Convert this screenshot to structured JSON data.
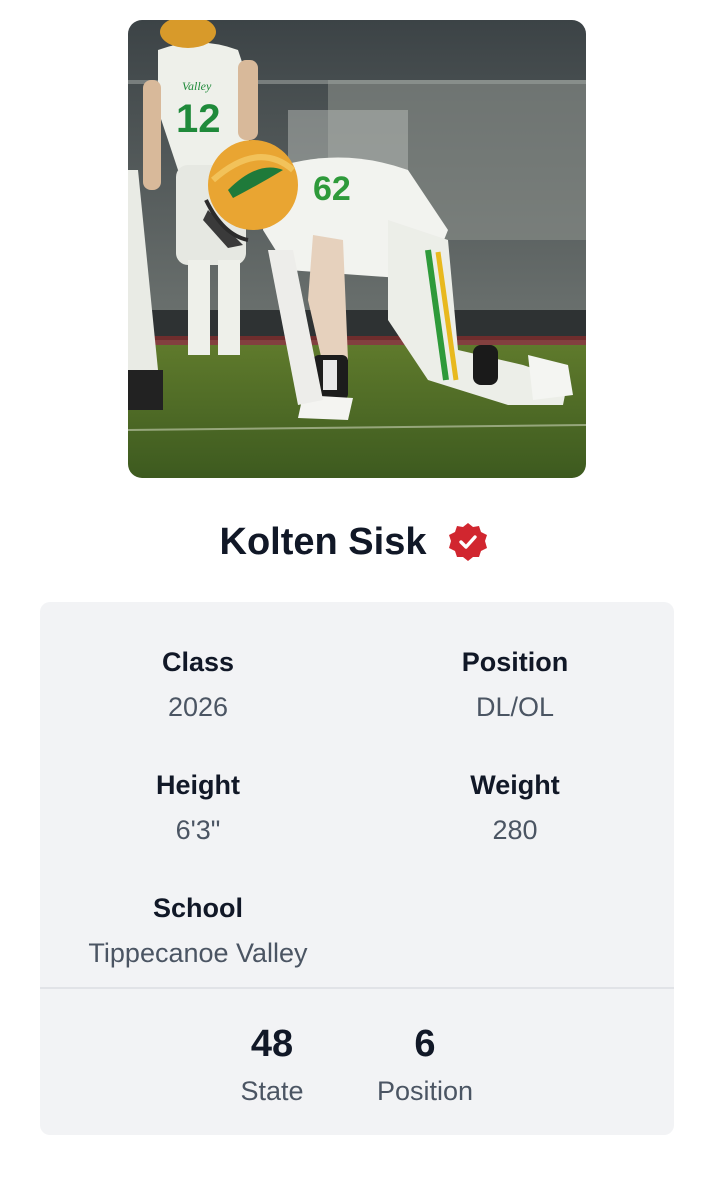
{
  "profile": {
    "name": "Kolten Sisk",
    "verified_color": "#d1262f",
    "photo": {
      "icon": "player-photo",
      "jersey_number": "12",
      "team_wordmark": "Valley"
    }
  },
  "details": {
    "class_label": "Class",
    "class_value": "2026",
    "position_label": "Position",
    "position_value": "DL/OL",
    "height_label": "Height",
    "height_value": "6'3\"",
    "weight_label": "Weight",
    "weight_value": "280",
    "school_label": "School",
    "school_value": "Tippecanoe Valley"
  },
  "rankings": {
    "state_rank": "48",
    "state_label": "State",
    "position_rank": "6",
    "position_label": "Position"
  },
  "colors": {
    "card_background": "#f2f3f5",
    "text_primary": "#111827",
    "text_secondary": "#4b5563"
  }
}
